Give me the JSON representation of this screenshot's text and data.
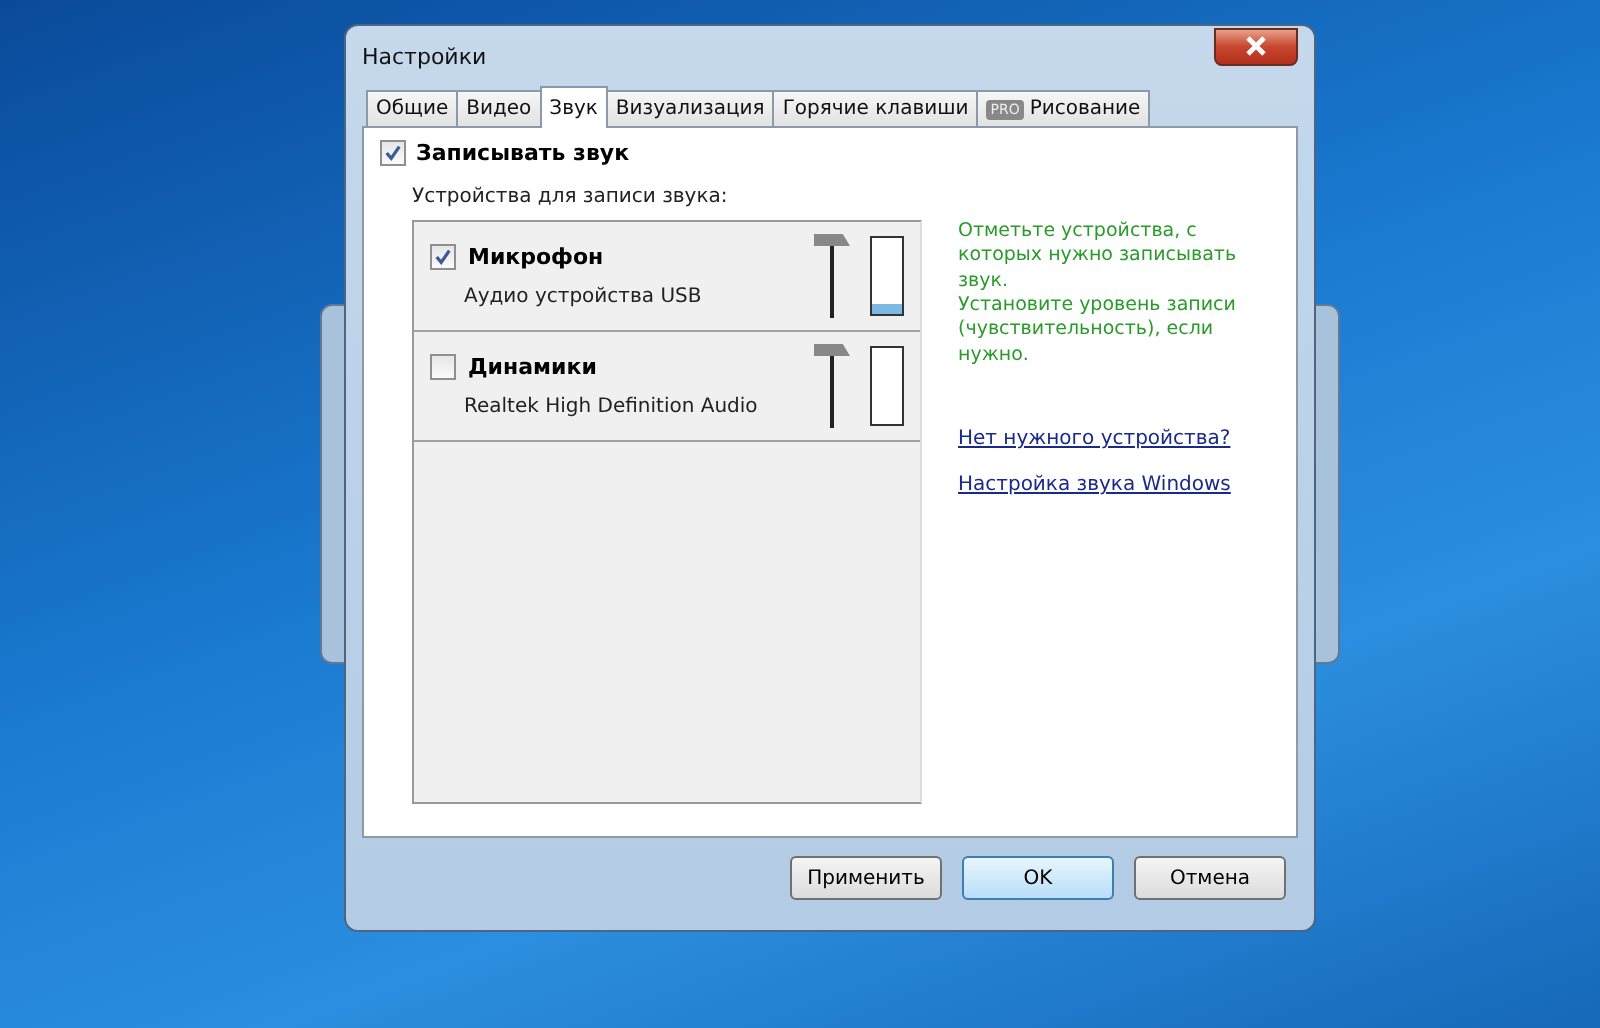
{
  "window": {
    "title": "Настройки"
  },
  "tabs": [
    {
      "label": "Общие",
      "selected": false
    },
    {
      "label": "Видео",
      "selected": false
    },
    {
      "label": "Звук",
      "selected": true
    },
    {
      "label": "Визуализация",
      "selected": false
    },
    {
      "label": "Горячие клавиши",
      "selected": false
    },
    {
      "label": "Рисование",
      "selected": false,
      "badge": "PRO"
    }
  ],
  "record_sound": {
    "label": "Записывать звук",
    "checked": true
  },
  "devices_label": "Устройства для записи звука:",
  "devices": [
    {
      "name": "Микрофон",
      "description": "Аудио устройства USB",
      "checked": true,
      "slider": {
        "level": 1
      },
      "meter": {
        "level": 0.12
      }
    },
    {
      "name": "Динамики",
      "description": "Realtek High Definition Audio",
      "checked": false,
      "slider": {
        "level": 1
      },
      "meter": {
        "level": 0
      }
    }
  ],
  "hint": "Отметьте устройства, с которых нужно записывать звук.\nУстановите уровень записи (чувствительность), если нужно.",
  "links": [
    "Нет нужного устройства?",
    "Настройка звука Windows"
  ],
  "buttons": [
    {
      "label": "Применить",
      "selected": false
    },
    {
      "label": "OK",
      "selected": true
    },
    {
      "label": "Отмена",
      "selected": false
    }
  ]
}
